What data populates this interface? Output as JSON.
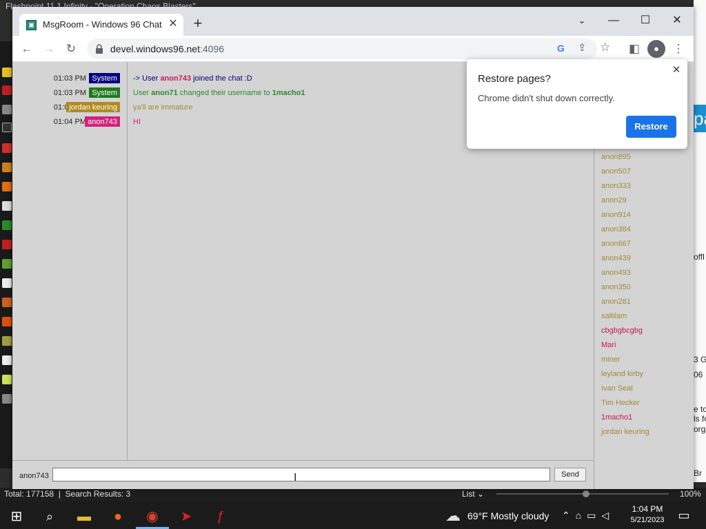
{
  "desktop": {
    "behind_title": "Flashpoint 11.1 Infinity - \"Operation Chaos Blasters\"",
    "behind_right_lines": [
      "offl",
      "3 G",
      "06",
      "e to",
      "ls fo",
      "org/",
      "Br"
    ],
    "status_total": "Total: 177158",
    "status_search": "Search Results: 3",
    "status_view": "List",
    "status_zoom": "100%"
  },
  "browser": {
    "tab_title": "MsgRoom - Windows 96 Chat",
    "url_host": "devel.windows96.net",
    "url_port": ":4096"
  },
  "chat": {
    "messages": [
      {
        "time": "01:03 PM",
        "user": "System",
        "user_bg": "#000080",
        "parts": [
          [
            "-> User ",
            "#000080",
            false
          ],
          [
            "anon743",
            "#cc1a5e",
            true
          ],
          [
            " joined the chat :D",
            "#000080",
            false
          ]
        ]
      },
      {
        "time": "01:03 PM",
        "user": "System",
        "user_bg": "#1f7a1f",
        "parts": [
          [
            "User ",
            "#2a8a2a",
            false
          ],
          [
            "anon71",
            "#2a8a2a",
            true
          ],
          [
            " changed their username to ",
            "#2a8a2a",
            false
          ],
          [
            "1macho1",
            "#2a8a2a",
            true
          ]
        ]
      },
      {
        "time": "01:03 PM",
        "user": "jordan keuring",
        "user_bg": "#b08a20",
        "parts": [
          [
            "ya'll are immature",
            "#a08a3a",
            false
          ]
        ]
      },
      {
        "time": "01:04 PM",
        "user": "anon743",
        "user_bg": "#d4207a",
        "parts": [
          [
            "HI",
            "#d4207a",
            false
          ]
        ]
      }
    ],
    "users": [
      {
        "name": "anon895",
        "color": "#a08a3a"
      },
      {
        "name": "anon507",
        "color": "#a08a3a"
      },
      {
        "name": "anon333",
        "color": "#a08a3a"
      },
      {
        "name": "anon29",
        "color": "#a08a3a"
      },
      {
        "name": "anon914",
        "color": "#a08a3a"
      },
      {
        "name": "anon384",
        "color": "#a08a3a"
      },
      {
        "name": "anon667",
        "color": "#a08a3a"
      },
      {
        "name": "anon439",
        "color": "#a08a3a"
      },
      {
        "name": "anon493",
        "color": "#a08a3a"
      },
      {
        "name": "anon350",
        "color": "#a08a3a"
      },
      {
        "name": "anon281",
        "color": "#a08a3a"
      },
      {
        "name": "saltiiam",
        "color": "#a08a3a"
      },
      {
        "name": "cbgbgbcgbg",
        "color": "#c41a50"
      },
      {
        "name": "Mari",
        "color": "#c41a50"
      },
      {
        "name": "miner",
        "color": "#a08a3a"
      },
      {
        "name": "leyland kirby",
        "color": "#a08a3a"
      },
      {
        "name": "Ivan Seal",
        "color": "#a08a3a"
      },
      {
        "name": "Tim Hecker",
        "color": "#a08a3a"
      },
      {
        "name": "1macho1",
        "color": "#c41a50"
      },
      {
        "name": "jordan keuring",
        "color": "#a08a3a"
      }
    ],
    "input_nick": "anon743",
    "input_value": "",
    "send_label": "Send"
  },
  "popup": {
    "title": "Restore pages?",
    "message": "Chrome didn't shut down correctly.",
    "button_label": "Restore"
  },
  "taskbar": {
    "weather": "69°F  Mostly cloudy",
    "time": "1:04 PM",
    "date": "5/21/2023"
  }
}
